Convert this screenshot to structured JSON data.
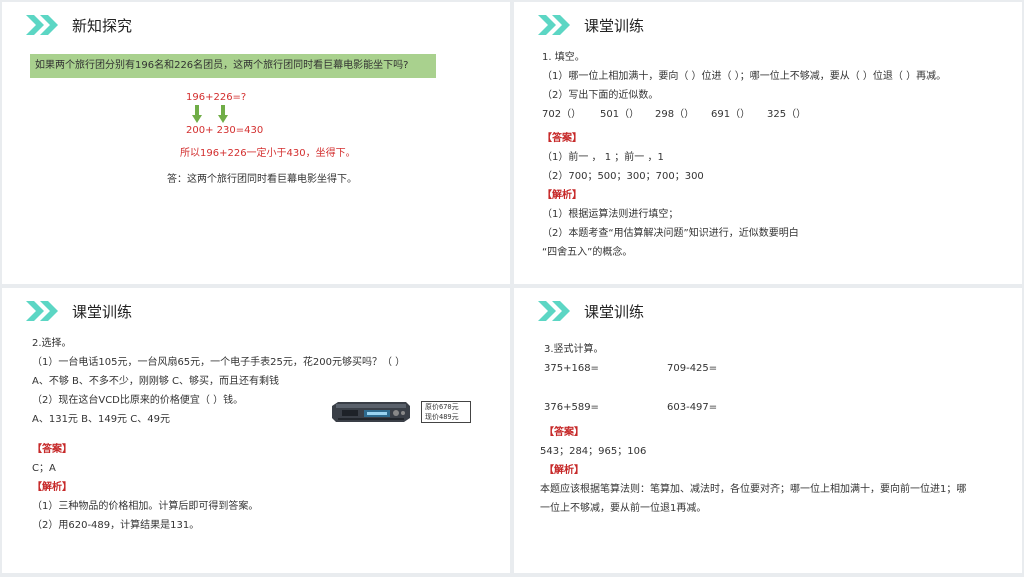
{
  "panel1": {
    "title": "新知探究",
    "question": "如果两个旅行团分别有196名和226名团员，这两个旅行团同时看巨幕电影能坐下吗?",
    "expr": "196+226=?",
    "estimate": "200+ 230=430",
    "conclusion": "所以196+226一定小于430，坐得下。",
    "answer": "答：这两个旅行团同时看巨幕电影坐得下。"
  },
  "panel2": {
    "title": "课堂训练",
    "q_head": "1. 填空。",
    "q1": "（1）哪一位上相加满十，要向（  ）位进（  ）；哪一位上不够减，要从（  ）位退（  ）再减。",
    "q2": "（2）写出下面的近似数。",
    "items": [
      "702（）",
      "501（）",
      "298（）",
      "691（）",
      "325（）"
    ],
    "answer_label": "【答案】",
    "a1": "（1）前一 ，  1 ；前一 ，1",
    "a2": "（2）700；500；300；700；300",
    "analysis_label": "【解析】",
    "e1": "（1）根据运算法则进行填空；",
    "e2": "（2）本题考查“用估算解决问题”知识进行，近似数要明白",
    "e3": "“四舍五入”的概念。"
  },
  "panel3": {
    "title": "课堂训练",
    "q_head": "2.选择。",
    "q1": "（1）一台电话105元，一台风扇65元，一个电子手表25元，花200元够买吗？（  ）",
    "opts1": "A、不够     B、不多不少，刚刚够    C、够买，而且还有剩钱",
    "q2": "（2）现在这台VCD比原来的价格便宜（    ）钱。",
    "opts2": "A、131元    B、149元    C、49元",
    "price1": "原价670元",
    "price2": "现价489元",
    "answer_label": "【答案】",
    "answer": "C；A",
    "analysis_label": "【解析】",
    "e1": "（1）三种物品的价格相加。计算后即可得到答案。",
    "e2": "（2）用620-489，计算结果是131。"
  },
  "panel4": {
    "title": "课堂训练",
    "q_head": "3.竖式计算。",
    "c1": "375+168=",
    "c2": "709-425=",
    "c3": "376+589=",
    "c4": "603-497=",
    "answer_label": "【答案】",
    "answer": "543；284；965；106",
    "analysis_label": "【解析】",
    "e1": "本题应该根据笔算法则：笔算加、减法时，各位要对齐；哪一位上相加满十，要向前一位进1；哪",
    "e2": "一位上不够减，要从前一位退1再减。"
  },
  "colors": {
    "accent": "#5cd6c4",
    "banner": "#a9d18e",
    "red": "#d32f2f",
    "arrow": "#70ad47"
  }
}
